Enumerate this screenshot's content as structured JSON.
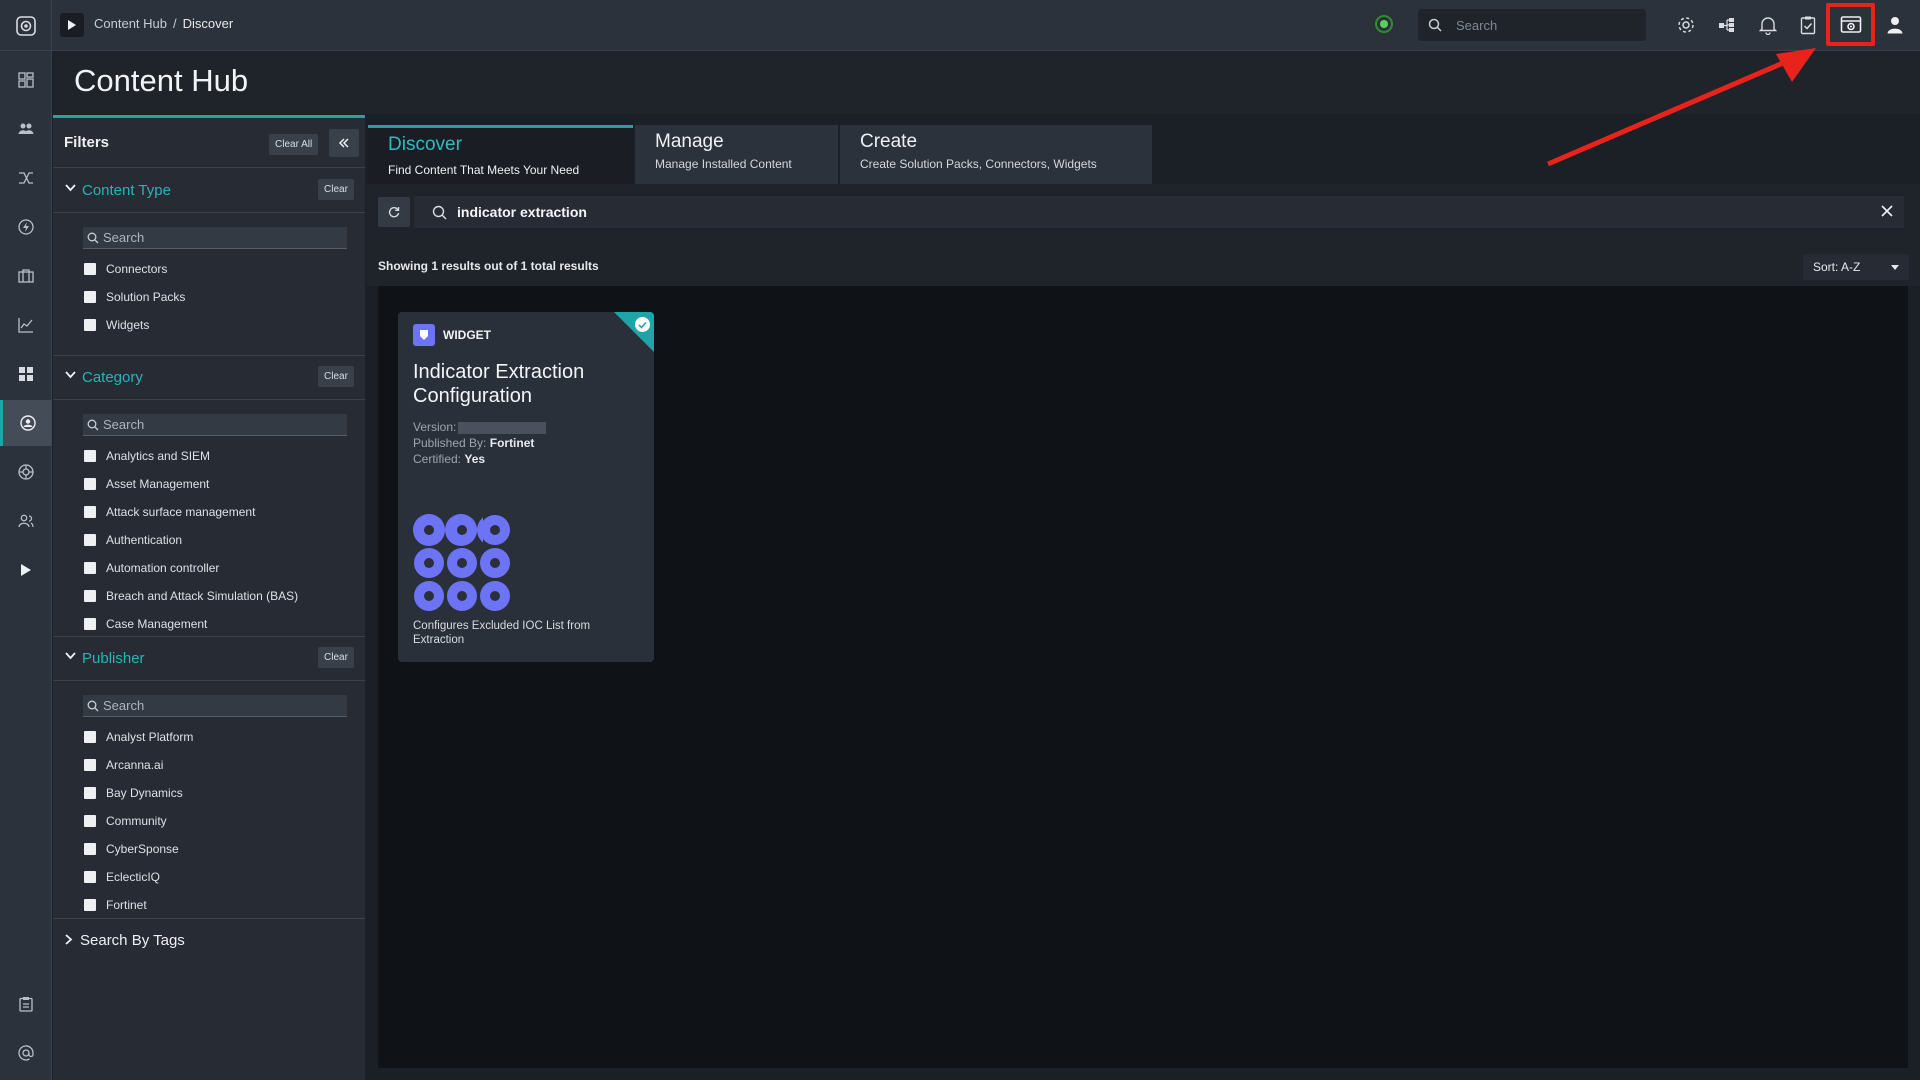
{
  "breadcrumb": {
    "parent": "Content Hub",
    "separator": "/",
    "current": "Discover"
  },
  "top_search": {
    "placeholder": "Search"
  },
  "page": {
    "title": "Content Hub"
  },
  "filters": {
    "title": "Filters",
    "clear_all": "Clear All",
    "sections": {
      "content_type": {
        "title": "Content Type",
        "clear": "Clear",
        "search_placeholder": "Search",
        "items": [
          "Connectors",
          "Solution Packs",
          "Widgets"
        ]
      },
      "category": {
        "title": "Category",
        "clear": "Clear",
        "search_placeholder": "Search",
        "items": [
          "Analytics and SIEM",
          "Asset Management",
          "Attack surface management",
          "Authentication",
          "Automation controller",
          "Breach and Attack Simulation (BAS)",
          "Case Management"
        ]
      },
      "publisher": {
        "title": "Publisher",
        "clear": "Clear",
        "search_placeholder": "Search",
        "items": [
          "Analyst Platform",
          "Arcanna.ai",
          "Bay Dynamics",
          "Community",
          "CyberSponse",
          "EclecticIQ",
          "Fortinet"
        ]
      }
    },
    "tags_label": "Search By Tags"
  },
  "tabs": [
    {
      "title": "Discover",
      "subtitle": "Find Content That Meets Your Need"
    },
    {
      "title": "Manage",
      "subtitle": "Manage Installed Content"
    },
    {
      "title": "Create",
      "subtitle": "Create Solution Packs, Connectors, Widgets"
    }
  ],
  "search": {
    "query": "indicator extraction"
  },
  "results": {
    "summary": "Showing 1 results out of 1 total results",
    "sort": "Sort: A-Z"
  },
  "card": {
    "type": "WIDGET",
    "title": "Indicator Extraction Configuration",
    "version_label": "Version:",
    "published_label": "Published By:",
    "published_value": "Fortinet",
    "certified_label": "Certified:",
    "certified_value": "Yes",
    "description": "Configures Excluded IOC List from Extraction"
  },
  "colors": {
    "accent": "#1fa5a8",
    "highlight": "#e8231b",
    "widget_badge": "#6d73f5",
    "status_ok": "#5ad15a"
  },
  "icons": [
    "app-logo-icon",
    "play-icon",
    "status-icon",
    "search-icon",
    "gear-icon",
    "hierarchy-icon",
    "bell-icon",
    "clipboard-check-icon",
    "content-hub-settings-icon",
    "user-icon",
    "double-chevron-left-icon",
    "chevron-down-icon",
    "chevron-right-icon",
    "refresh-icon",
    "close-icon",
    "check-icon",
    "widget-icon"
  ]
}
